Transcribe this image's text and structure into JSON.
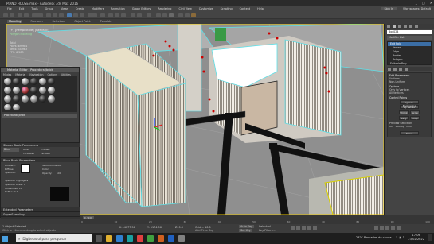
{
  "window": {
    "title": "PIANO HOUSE.max - Autodesk 3ds Max 2016",
    "controls": [
      "_",
      "□",
      "✕"
    ]
  },
  "menubar": {
    "items": [
      "File",
      "Edit",
      "Tools",
      "Group",
      "Views",
      "Create",
      "Modifiers",
      "Animation",
      "Graph Editors",
      "Rendering",
      "Civil View",
      "Customize",
      "Scripting",
      "Content",
      "Help"
    ],
    "sign_in": "Sign In",
    "workspace": "Workspaces: Default"
  },
  "ribbon": {
    "tabs": [
      "Modeling",
      "Freeform",
      "Selection",
      "Object Paint",
      "Populate"
    ],
    "active": 0
  },
  "viewport": {
    "label": "[+] [Perspective] [Realistic]",
    "polygon_label": "Polygon Modeling",
    "stats": [
      "Total",
      "Polys: 69,984",
      "Verts: 34,963",
      "FPS: 6.583"
    ]
  },
  "material_editor": {
    "title": "Material Editor - Procedural/brick",
    "menu": [
      "Modes",
      "Material",
      "Navigation",
      "Options",
      "Utilities"
    ],
    "name_field": "Procedural_brick",
    "rollouts": [
      "Shader Basic Parameters",
      "Blinn Basic Parameters",
      "Extended Parameters",
      "SuperSampling",
      "Maps"
    ],
    "shader": "Blinn",
    "wire": "Wire",
    "two_sided": "2-Sided",
    "face_map": "Face Map",
    "faceted": "Faceted",
    "ambient": "Ambient:",
    "diffuse": "Diffuse:",
    "specular": "Specular:",
    "self_illum": "Self-Illumination",
    "color": "Color",
    "opacity": "Opacity:",
    "opacity_val": "100",
    "spec_hl": "Specular Highlights",
    "spec_level": "Specular Level:",
    "spec_level_val": "0",
    "glossiness": "Glossiness:",
    "gloss_val": "10",
    "soften": "Soften:",
    "soften_val": "0.1"
  },
  "command_panel": {
    "object_name": "Box024",
    "modifier_list": "Modifier List",
    "stack": [
      "Edit Poly",
      "Vertex",
      "Edge",
      "Border",
      "Polygon",
      "Element",
      "Editable Poly"
    ],
    "selected_index": 0,
    "rollout": "Edit Parameters",
    "radio_a": "Uniform",
    "radio_b": "Non-Uniform",
    "group_options": "Options",
    "check_a": "Only to Vertices",
    "check_b": "All Vertices",
    "group_control": "Control Points",
    "buttons": [
      "Ignore Backfacing",
      "By Vertex",
      "Shrink",
      "Grow",
      "Ring",
      "Loop"
    ],
    "extra_btn": "Preview Selection",
    "off": "Off",
    "subobj": "SubObj",
    "multi": "Multi",
    "reset": "Reset"
  },
  "timeline": {
    "frame": "0 / 100",
    "ticks": [
      "0",
      "10",
      "20",
      "30",
      "40",
      "50",
      "60",
      "70",
      "80",
      "90",
      "100"
    ]
  },
  "status": {
    "selection": "1 Object Selected",
    "hint": "Click or click-and-drag to select objects",
    "x": "X: -4077.56",
    "y": "Y: 1174.56",
    "z": "Z: 0.0",
    "grid": "Grid = 10.0",
    "auto_key": "Auto Key",
    "selected": "Selected",
    "set_key": "Set Key",
    "key_filters": "Key Filters...",
    "add_time_tag": "Add Time Tag"
  },
  "taskbar": {
    "search_placeholder": "Digite aqui para pesquisar",
    "weather": "23°C  Pancadas de chuva",
    "time": "17:06",
    "date": "23/02/2022"
  },
  "colors": {
    "accent": "#3b6ea5",
    "wall_cap": "#e8e0c8",
    "floor": "#8c8c8c",
    "wall_trim": "#5ee0e8"
  }
}
